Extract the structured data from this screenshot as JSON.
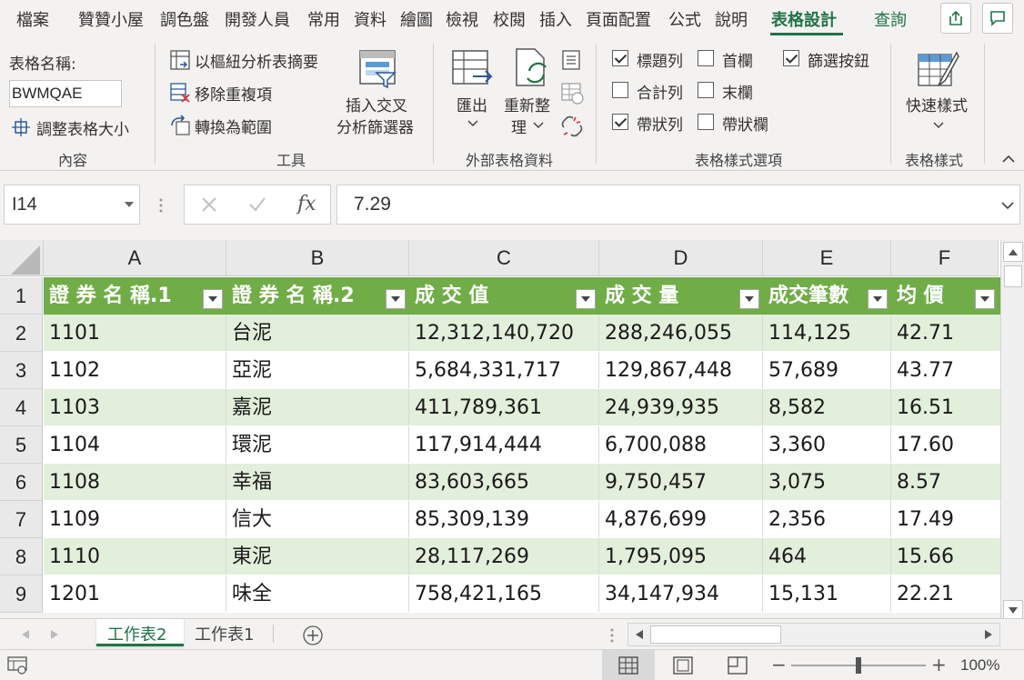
{
  "ribbon_tabs": [
    "檔案",
    "贊贊小屋",
    "調色盤",
    "開發人員",
    "常用",
    "資料",
    "繪圖",
    "檢視",
    "校閱",
    "插入",
    "頁面配置",
    "公式",
    "說明",
    "表格設計",
    "查詢"
  ],
  "ribbon": {
    "properties": {
      "table_name_label": "表格名稱:",
      "table_name_value": "BWMQAE",
      "resize_label": "調整表格大小",
      "group_label": "內容"
    },
    "tools": {
      "pivot_label": "以樞紐分析表摘要",
      "remove_dup_label": "移除重複項",
      "convert_label": "轉換為範圍",
      "slicer_line1": "插入交叉",
      "slicer_line2": "分析篩選器",
      "group_label": "工具"
    },
    "external": {
      "export_label": "匯出",
      "refresh_line1": "重新整",
      "refresh_line2": "理",
      "group_label": "外部表格資料"
    },
    "style_options": {
      "header_row": "標題列",
      "total_row": "合計列",
      "banded_rows": "帶狀列",
      "first_column": "首欄",
      "last_column": "末欄",
      "banded_columns": "帶狀欄",
      "filter_button": "篩選按鈕",
      "group_label": "表格樣式選項"
    },
    "styles": {
      "quick_styles_label": "快速樣式",
      "group_label": "表格樣式"
    }
  },
  "formula_bar": {
    "name_box": "I14",
    "fx": "fx",
    "formula": "7.29"
  },
  "column_headers": [
    "A",
    "B",
    "C",
    "D",
    "E",
    "F"
  ],
  "table": {
    "headers": [
      "證 券 名 稱.1",
      "證 券 名 稱.2",
      "成 交 值",
      "成 交 量",
      "成交筆數",
      "均 價"
    ],
    "rows": [
      [
        "1101",
        "台泥",
        "12,312,140,720",
        "288,246,055",
        "114,125",
        "42.71"
      ],
      [
        "1102",
        "亞泥",
        "5,684,331,717",
        "129,867,448",
        "57,689",
        "43.77"
      ],
      [
        "1103",
        "嘉泥",
        "411,789,361",
        "24,939,935",
        "8,582",
        "16.51"
      ],
      [
        "1104",
        "環泥",
        "117,914,444",
        "6,700,088",
        "3,360",
        "17.60"
      ],
      [
        "1108",
        "幸福",
        "83,603,665",
        "9,750,457",
        "3,075",
        "8.57"
      ],
      [
        "1109",
        "信大",
        "85,309,139",
        "4,876,699",
        "2,356",
        "17.49"
      ],
      [
        "1110",
        "東泥",
        "28,117,269",
        "1,795,095",
        "464",
        "15.66"
      ],
      [
        "1201",
        "味全",
        "758,421,165",
        "34,147,934",
        "15,131",
        "22.21"
      ]
    ]
  },
  "row_numbers": [
    "1",
    "2",
    "3",
    "4",
    "5",
    "6",
    "7",
    "8",
    "9"
  ],
  "sheet_tabs": [
    "工作表2",
    "工作表1"
  ],
  "status": {
    "zoom": "100%",
    "zoom_level_percent": 100
  },
  "colors": {
    "accent": "#217346",
    "table_header": "#70ad47",
    "band": "#e2efda"
  }
}
